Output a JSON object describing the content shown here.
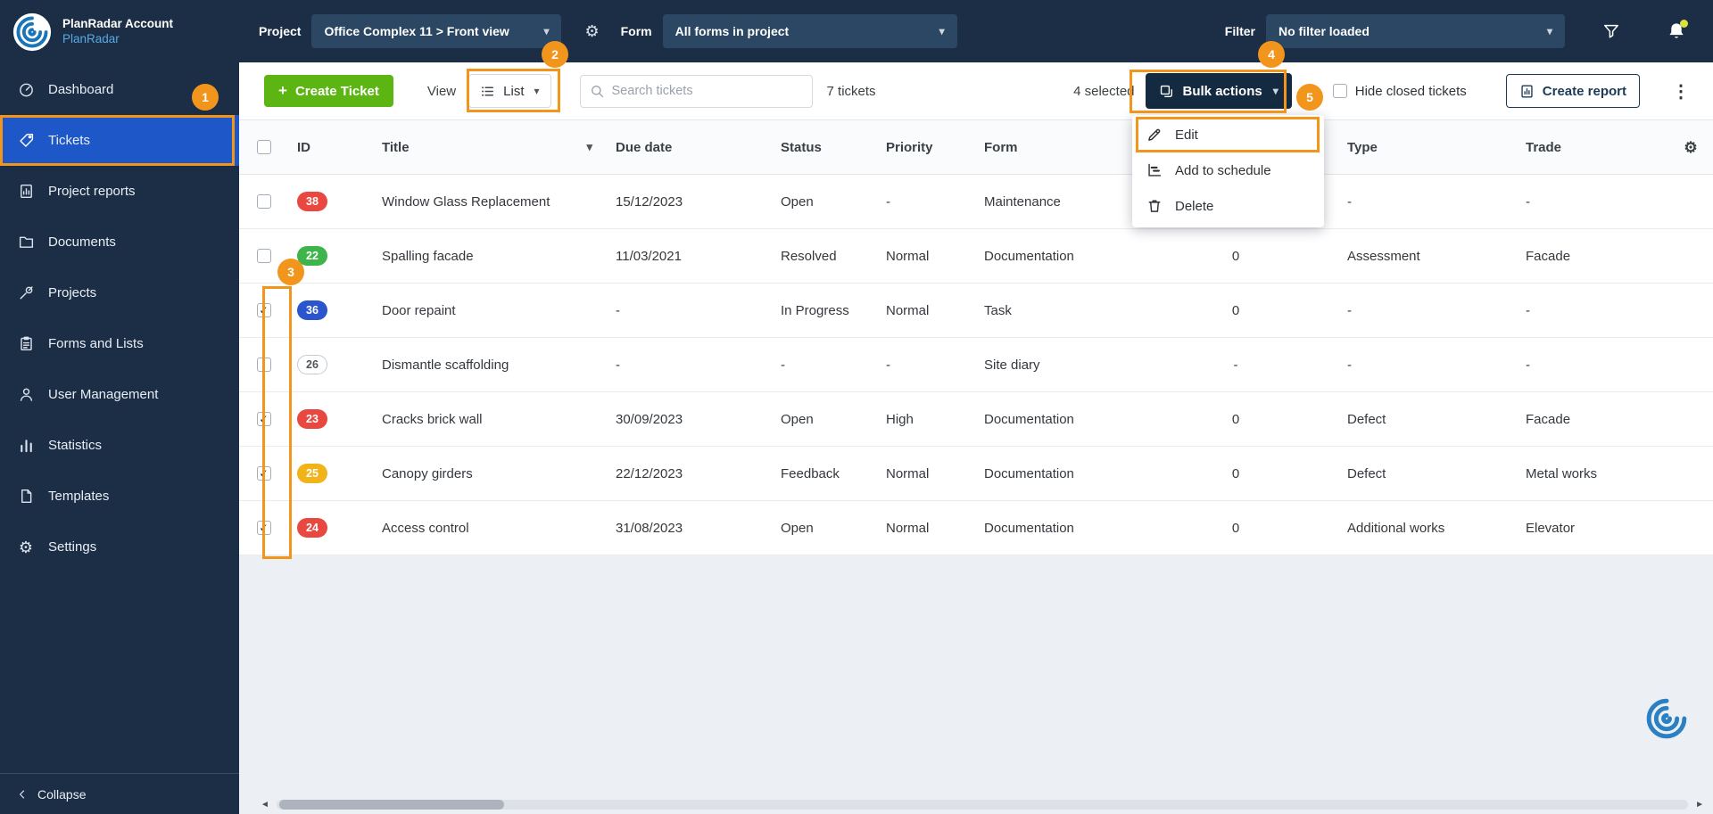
{
  "icons": {
    "caret_down": "▾",
    "kebab": "⋮",
    "plus": "+",
    "gear": "⚙",
    "scroll_left": "◄",
    "scroll_right": "►"
  },
  "sidebar": {
    "account_label": "PlanRadar Account",
    "account_name": "PlanRadar",
    "items": [
      {
        "label": "Dashboard"
      },
      {
        "label": "Tickets"
      },
      {
        "label": "Project reports"
      },
      {
        "label": "Documents"
      },
      {
        "label": "Projects"
      },
      {
        "label": "Forms and Lists"
      },
      {
        "label": "User Management"
      },
      {
        "label": "Statistics"
      },
      {
        "label": "Templates"
      },
      {
        "label": "Settings"
      }
    ],
    "collapse_label": "Collapse"
  },
  "topbar": {
    "project_label": "Project",
    "project_value": "Office Complex 11 > Front view",
    "form_label": "Form",
    "form_value": "All forms in project",
    "filter_label": "Filter",
    "filter_value": "No filter loaded"
  },
  "toolbar": {
    "create_ticket_label": "Create Ticket",
    "view_label": "View",
    "view_value": "List",
    "search_placeholder": "Search tickets",
    "tickets_count": "7 tickets",
    "selected_count": "4 selected",
    "bulk_actions_label": "Bulk actions",
    "hide_closed_label": "Hide closed tickets",
    "hide_closed_checked": "",
    "create_report_label": "Create report"
  },
  "bulk_menu": {
    "items": [
      {
        "label": "Edit"
      },
      {
        "label": "Add to schedule"
      },
      {
        "label": "Delete"
      }
    ]
  },
  "table": {
    "select_all_glyph": "",
    "headers": [
      "ID",
      "Title",
      "Due date",
      "Status",
      "Priority",
      "Form",
      "",
      "Type",
      "Trade"
    ],
    "rows": [
      {
        "check_glyph": "",
        "id": "38",
        "id_bg": "#e8483f",
        "id_fg": "#ffffff",
        "id_border": "transparent",
        "title": "Window Glass Replacement",
        "due": "15/12/2023",
        "status": "Open",
        "priority": "-",
        "form": "Maintenance",
        "num": "",
        "type": "-",
        "trade": "-"
      },
      {
        "check_glyph": "",
        "id": "22",
        "id_bg": "#3eb54b",
        "id_fg": "#ffffff",
        "id_border": "transparent",
        "title": "Spalling facade",
        "due": "11/03/2021",
        "status": "Resolved",
        "priority": "Normal",
        "form": "Documentation",
        "num": "0",
        "type": "Assessment",
        "trade": "Facade"
      },
      {
        "check_glyph": "✓",
        "id": "36",
        "id_bg": "#2b55cc",
        "id_fg": "#ffffff",
        "id_border": "transparent",
        "title": "Door repaint",
        "due": "-",
        "status": "In Progress",
        "priority": "Normal",
        "form": "Task",
        "num": "0",
        "type": "-",
        "trade": "-"
      },
      {
        "check_glyph": "",
        "id": "26",
        "id_bg": "#ffffff",
        "id_fg": "#50555b",
        "id_border": "#c6cbd2",
        "title": "Dismantle scaffolding",
        "due": "-",
        "status": "-",
        "priority": "-",
        "form": "Site diary",
        "num": "-",
        "type": "-",
        "trade": "-"
      },
      {
        "check_glyph": "✓",
        "id": "23",
        "id_bg": "#e8483f",
        "id_fg": "#ffffff",
        "id_border": "transparent",
        "title": "Cracks brick wall",
        "due": "30/09/2023",
        "status": "Open",
        "priority": "High",
        "form": "Documentation",
        "num": "0",
        "type": "Defect",
        "trade": "Facade"
      },
      {
        "check_glyph": "✓",
        "id": "25",
        "id_bg": "#f0b419",
        "id_fg": "#ffffff",
        "id_border": "transparent",
        "title": "Canopy girders",
        "due": "22/12/2023",
        "status": "Feedback",
        "priority": "Normal",
        "form": "Documentation",
        "num": "0",
        "type": "Defect",
        "trade": "Metal works"
      },
      {
        "check_glyph": "✓",
        "id": "24",
        "id_bg": "#e8483f",
        "id_fg": "#ffffff",
        "id_border": "transparent",
        "title": "Access control",
        "due": "31/08/2023",
        "status": "Open",
        "priority": "Normal",
        "form": "Documentation",
        "num": "0",
        "type": "Additional works",
        "trade": "Elevator"
      }
    ]
  },
  "annotations": {
    "color": "#f2951d",
    "steps": [
      "1",
      "2",
      "3",
      "4",
      "5"
    ]
  },
  "colors": {
    "navy": "#1b2e45",
    "active_blue": "#1e58c8",
    "green": "#5cb513",
    "orange": "#f2951d",
    "badge_red": "#e8483f",
    "badge_green": "#3eb54b",
    "badge_blue": "#2b55cc",
    "badge_yellow": "#f0b419"
  }
}
